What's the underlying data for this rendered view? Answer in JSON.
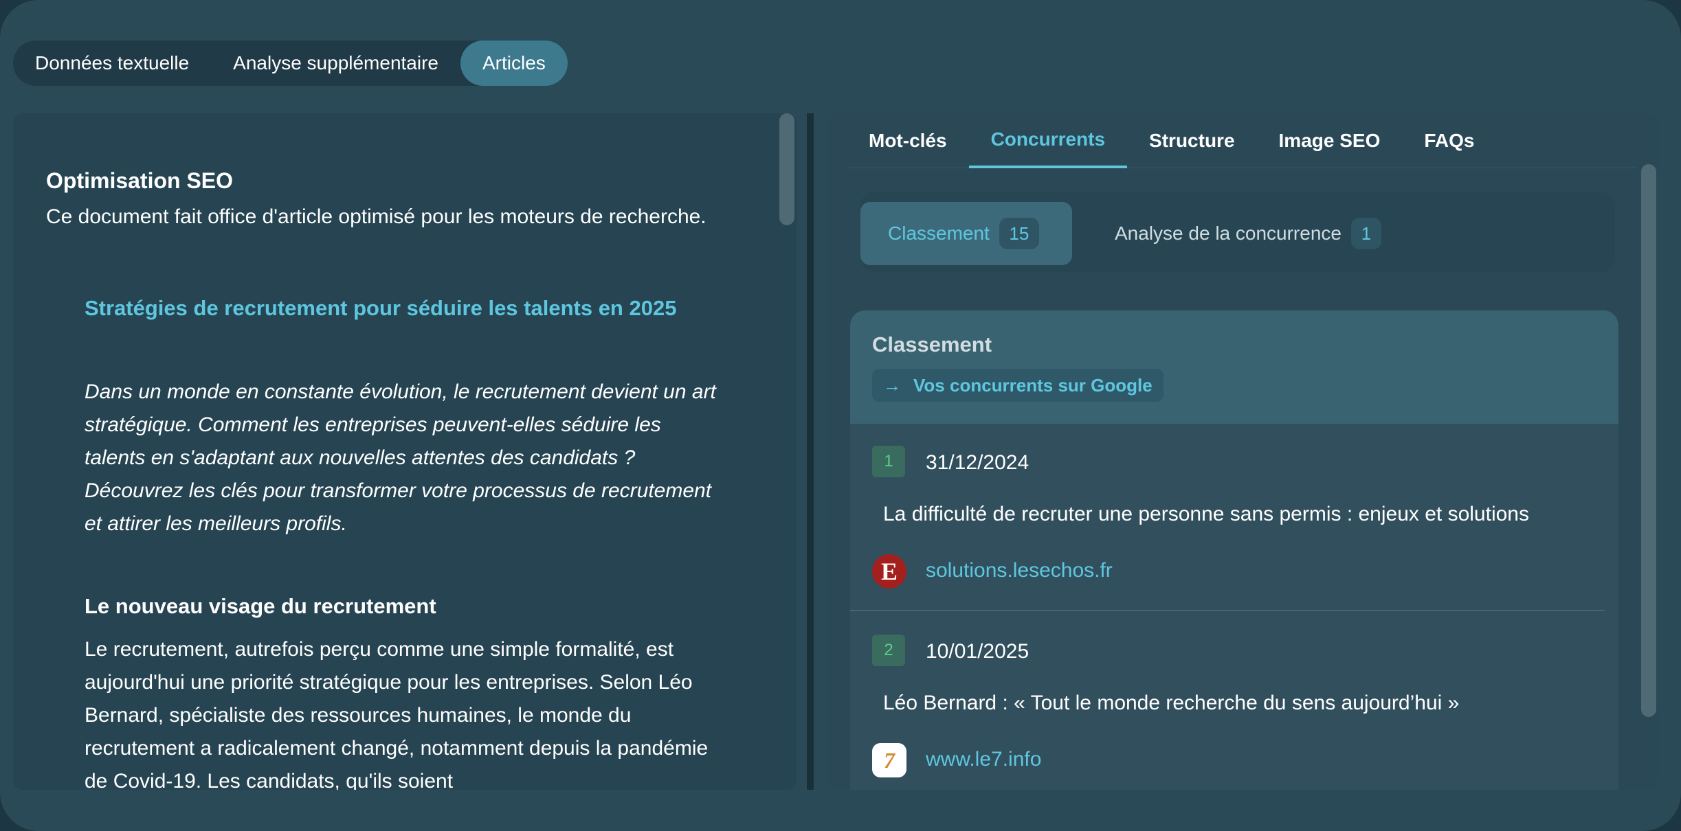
{
  "top_tabs": [
    {
      "label": "Données textuelle"
    },
    {
      "label": "Analyse supplémentaire"
    },
    {
      "label": "Articles"
    }
  ],
  "document": {
    "heading": "Optimisation SEO",
    "description": "Ce document fait office d'article optimisé pour les moteurs de recherche.",
    "article_title": "Stratégies de recrutement pour séduire les talents en 2025",
    "intro": "Dans un monde en constante évolution, le recrutement devient un art stratégique. Comment les entreprises peuvent-elles séduire les talents en s'adaptant aux nouvelles attentes des candidats ? Découvrez les clés pour transformer votre processus de recrutement et attirer les meilleurs profils.",
    "section_title": "Le nouveau visage du recrutement",
    "section_body": "Le recrutement, autrefois perçu comme une simple formalité, est aujourd'hui une priorité stratégique pour les entreprises. Selon Léo Bernard, spécialiste des ressources humaines, le monde du recrutement a radicalement changé, notamment depuis la pandémie de Covid-19. Les candidats, qu'ils soient"
  },
  "sub_tabs": [
    {
      "label": "Mot-clés"
    },
    {
      "label": "Concurrents"
    },
    {
      "label": "Structure"
    },
    {
      "label": "Image SEO"
    },
    {
      "label": "FAQs"
    }
  ],
  "segments": {
    "classement": {
      "label": "Classement",
      "count": "15"
    },
    "analyse": {
      "label": "Analyse de la concurrence",
      "count": "1"
    }
  },
  "ranking": {
    "title": "Classement",
    "google_link": "Vos concurrents sur Google",
    "items": [
      {
        "rank": "1",
        "date": "31/12/2024",
        "title": "La difficulté de recruter une personne sans permis : enjeux et solutions",
        "favicon_letter": "E",
        "domain": "solutions.lesechos.fr"
      },
      {
        "rank": "2",
        "date": "10/01/2025",
        "title": "Léo Bernard : « Tout le monde recherche du sens aujourd’hui »",
        "favicon_letter": "7",
        "domain": "www.le7.info"
      }
    ]
  },
  "colors": {
    "accent": "#5ec7df",
    "active_tab": "#3d7a8e",
    "background": "#2b4a58",
    "rank_badge": "#5ccf8a"
  }
}
